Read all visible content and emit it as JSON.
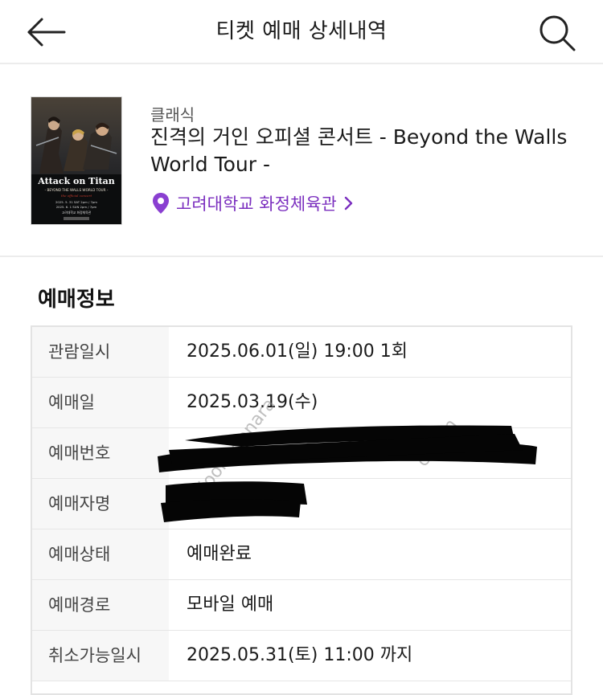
{
  "header": {
    "title": "티켓 예매 상세내역"
  },
  "event": {
    "category": "클래식",
    "title": "진격의 거인 오피셜 콘서트 - Beyond the Walls World Tour -",
    "venue": "고려대학교 화정체육관",
    "poster": {
      "title": "Attack on Titan",
      "subtitle": "- BEYOND THE WALLS WORLD TOUR -",
      "tagline": "the official concert",
      "date_line_1": "2025. 5. 31 SAT 2pm / 7pm",
      "date_line_2": "2025. 6. 1 SUN 2pm / 7pm",
      "venue_line": "고려대학교 화정체육관"
    }
  },
  "booking_info": {
    "section_title": "예매정보",
    "rows": [
      {
        "label": "관람일시",
        "value": "2025.06.01(일) 19:00 1회"
      },
      {
        "label": "예매일",
        "value": "2025.03.19(수)"
      },
      {
        "label": "예매번호",
        "value": ""
      },
      {
        "label": "예매자명",
        "value": ""
      },
      {
        "label": "예매상태",
        "value": "예매완료"
      },
      {
        "label": "예매경로",
        "value": "모바일 예매"
      },
      {
        "label": "취소가능일시",
        "value": "2025.05.31(토) 11:00 까지"
      }
    ]
  },
  "watermarks": {
    "left": "joonggonara",
    "right": "cafe.n"
  },
  "colors": {
    "accent": "#7b2fbf",
    "text": "#1a1a1a",
    "divider": "#ececec",
    "label_bg": "#f7f7f7"
  },
  "icons": [
    "arrow-left-icon",
    "search-icon",
    "location-pin-icon",
    "chevron-right-icon"
  ]
}
